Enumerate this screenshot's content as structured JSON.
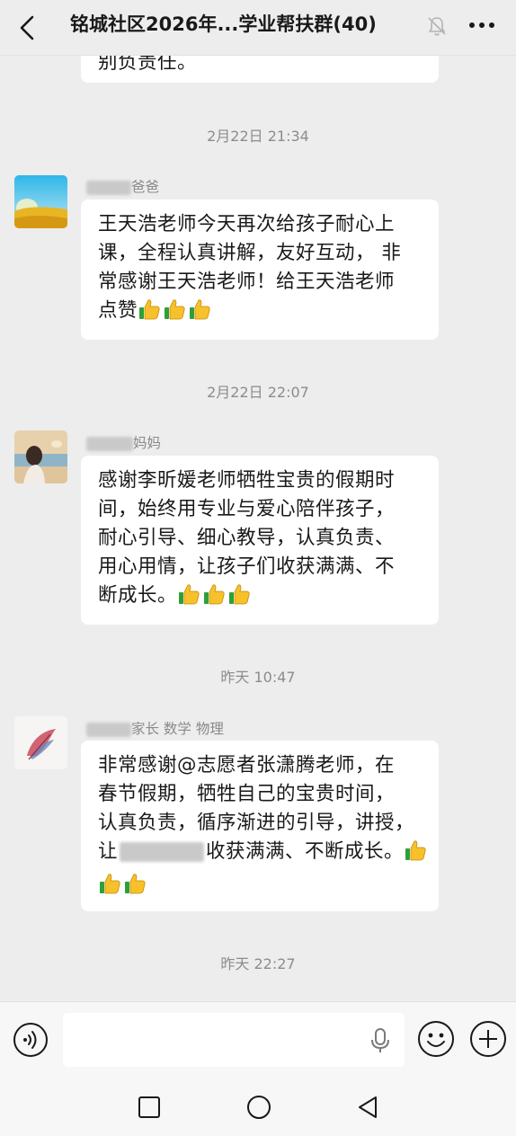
{
  "header": {
    "title": "铭城社区2026年...学业帮扶群(40)",
    "back_icon": "chevron-left-icon",
    "mute_icon": "bell-muted-icon",
    "more_icon": "more-dots-icon"
  },
  "messages": [
    {
      "type": "bubble",
      "lines": [
        "别负责任。"
      ]
    },
    {
      "type": "time",
      "text": "2月22日 21:34"
    },
    {
      "type": "msg",
      "sender_suffix": "爸爸",
      "avatar": "field-landscape",
      "lines": [
        "王天浩老师今天再次给孩子耐心上",
        "课，全程认真讲解，友好互动， 非",
        "常感谢王天浩老师！给王天浩老师",
        "点赞"
      ],
      "thumbs": 3
    },
    {
      "type": "time",
      "text": "2月22日 22:07"
    },
    {
      "type": "msg",
      "sender_suffix": "妈妈",
      "avatar": "girl-sea",
      "lines": [
        "感谢李昕媛老师牺牲宝贵的假期时",
        "间，始终用专业与爱心陪伴孩子，",
        "耐心引导、细心教导，认真负责、",
        "用心用情，让孩子们收获满满、不",
        "断成长。"
      ],
      "thumbs": 3
    },
    {
      "type": "time",
      "text": "昨天 10:47"
    },
    {
      "type": "msg",
      "sender_suffix": "家长 数学 物理",
      "avatar": "feather-art",
      "lines": [
        "非常感谢@志愿者张潇腾老师，在",
        "春节假期，牺牲自己的宝贵时间，",
        "认真负责，循序渐进的引导，讲授，",
        "让",
        "收获满满、不断成长。"
      ],
      "thumbs": 3
    },
    {
      "type": "time",
      "text": "昨天 22:27"
    }
  ],
  "input_bar": {
    "placeholder": "",
    "value": "",
    "voice_icon": "voice-icon",
    "mic_icon": "microphone-icon",
    "emoji_icon": "emoji-icon",
    "plus_icon": "plus-circle-icon"
  },
  "navbar": {
    "recent_icon": "square-icon",
    "home_icon": "circle-icon",
    "back_icon": "triangle-back-icon"
  },
  "colors": {
    "background": "#ededed",
    "bubble": "#ffffff",
    "text": "#191919",
    "meta_text": "#8c8c8c"
  }
}
